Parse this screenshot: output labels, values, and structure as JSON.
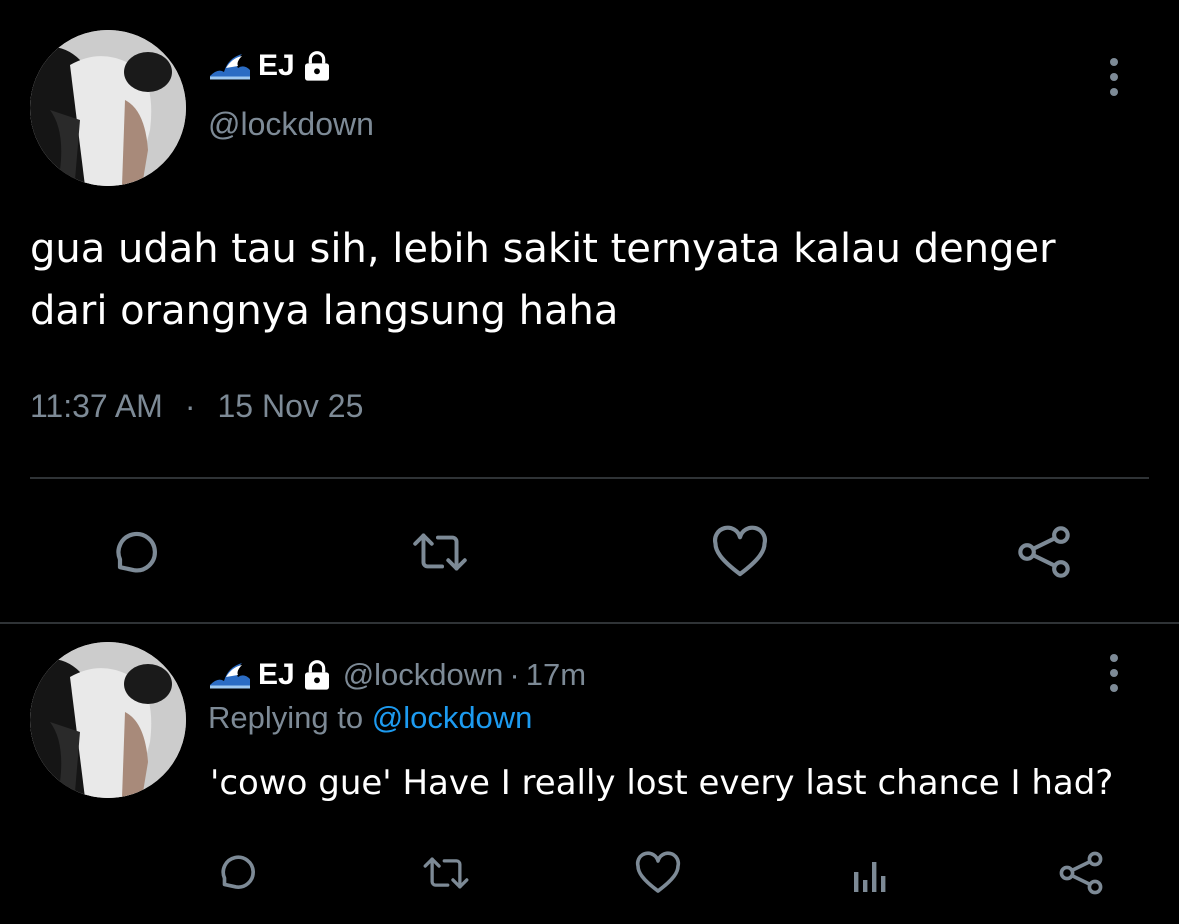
{
  "main_tweet": {
    "display_name": "EJ",
    "handle": "@lockdown",
    "text_line1": "gua udah tau sih, lebih sakit ternyata kalau denger",
    "text_line2": "dari orangnya langsung haha",
    "time": "11:37 AM",
    "separator": "·",
    "date": "15 Nov 25",
    "icons": {
      "reply": "comment-icon",
      "retweet": "retweet-icon",
      "like": "heart-icon",
      "share": "share-icon",
      "more": "more-vertical-icon"
    }
  },
  "reply_tweet": {
    "display_name": "EJ",
    "handle": "@lockdown",
    "dot": "·",
    "age": "17m",
    "replying_prefix": "Replying to ",
    "replying_handle": "@lockdown",
    "text": "'cowo gue' Have I really lost every last chance I had?",
    "icons": {
      "reply": "comment-icon",
      "retweet": "retweet-icon",
      "like": "heart-icon",
      "analytics": "bar-chart-icon",
      "share": "share-icon"
    }
  },
  "colors": {
    "background": "#000000",
    "text": "#ffffff",
    "muted": "#7d8a96",
    "link": "#1d9bf0",
    "divider": "#2f3336"
  }
}
